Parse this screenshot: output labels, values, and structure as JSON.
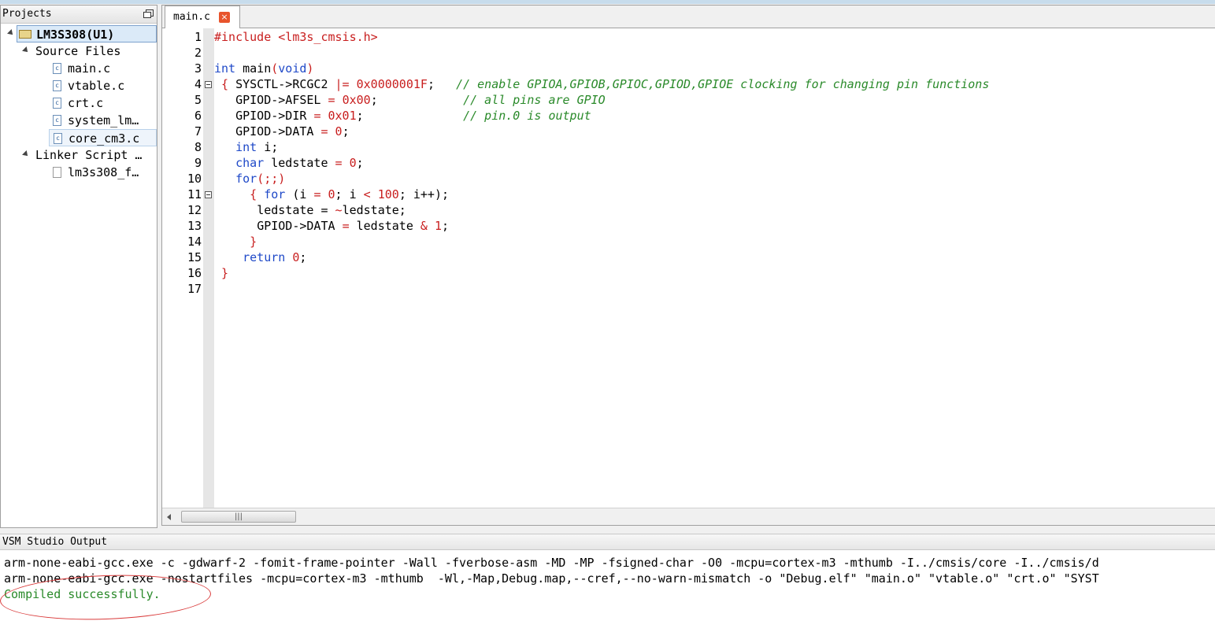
{
  "projects": {
    "title": "Projects",
    "root": "LM3S308(U1)",
    "source_folder": "Source Files",
    "source_files": [
      "main.c",
      "vtable.c",
      "crt.c",
      "system_lm…",
      "core_cm3.c"
    ],
    "linker_folder": "Linker Script …",
    "linker_files": [
      "lm3s308_f…"
    ]
  },
  "editor": {
    "tab_label": "main.c",
    "tab_close": "×",
    "scroll_grip": "|||",
    "line_numbers": [
      "1",
      "2",
      "3",
      "4",
      "5",
      "6",
      "7",
      "8",
      "9",
      "10",
      "11",
      "12",
      "13",
      "14",
      "15",
      "16",
      "17"
    ],
    "lines": [
      {
        "i": "",
        "t": [
          {
            "c": "pp",
            "v": "#include <lm3s_cmsis.h>"
          }
        ]
      },
      {
        "i": "",
        "t": []
      },
      {
        "i": "",
        "t": [
          {
            "c": "kw",
            "v": "int"
          },
          {
            "c": "",
            "v": " main"
          },
          {
            "c": "op",
            "v": "("
          },
          {
            "c": "kw",
            "v": "void"
          },
          {
            "c": "op",
            "v": ")"
          }
        ]
      },
      {
        "i": " ",
        "t": [
          {
            "c": "op",
            "v": "{"
          },
          {
            "c": "",
            "v": " SYSCTL->RCGC2 "
          },
          {
            "c": "op",
            "v": "|="
          },
          {
            "c": "",
            "v": " "
          },
          {
            "c": "num",
            "v": "0x0000001F"
          },
          {
            "c": "",
            "v": ";   "
          },
          {
            "c": "cm",
            "v": "// enable GPIOA,GPIOB,GPIOC,GPIOD,GPIOE clocking for changing pin functions"
          }
        ]
      },
      {
        "i": "   ",
        "t": [
          {
            "c": "",
            "v": "GPIOD->AFSEL "
          },
          {
            "c": "op",
            "v": "="
          },
          {
            "c": "",
            "v": " "
          },
          {
            "c": "num",
            "v": "0x00"
          },
          {
            "c": "",
            "v": ";            "
          },
          {
            "c": "cm",
            "v": "// all pins are GPIO"
          }
        ]
      },
      {
        "i": "   ",
        "t": [
          {
            "c": "",
            "v": "GPIOD->DIR "
          },
          {
            "c": "op",
            "v": "="
          },
          {
            "c": "",
            "v": " "
          },
          {
            "c": "num",
            "v": "0x01"
          },
          {
            "c": "",
            "v": ";              "
          },
          {
            "c": "cm",
            "v": "// pin.0 is output"
          }
        ]
      },
      {
        "i": "   ",
        "t": [
          {
            "c": "",
            "v": "GPIOD->DATA "
          },
          {
            "c": "op",
            "v": "="
          },
          {
            "c": "",
            "v": " "
          },
          {
            "c": "num",
            "v": "0"
          },
          {
            "c": "",
            "v": ";"
          }
        ]
      },
      {
        "i": "   ",
        "t": [
          {
            "c": "kw",
            "v": "int"
          },
          {
            "c": "",
            "v": " i;"
          }
        ]
      },
      {
        "i": "   ",
        "t": [
          {
            "c": "kw",
            "v": "char"
          },
          {
            "c": "",
            "v": " ledstate "
          },
          {
            "c": "op",
            "v": "="
          },
          {
            "c": "",
            "v": " "
          },
          {
            "c": "num",
            "v": "0"
          },
          {
            "c": "",
            "v": ";"
          }
        ]
      },
      {
        "i": "   ",
        "t": [
          {
            "c": "kw",
            "v": "for"
          },
          {
            "c": "op",
            "v": "(;;)"
          }
        ]
      },
      {
        "i": "     ",
        "t": [
          {
            "c": "op",
            "v": "{"
          },
          {
            "c": "",
            "v": " "
          },
          {
            "c": "kw",
            "v": "for"
          },
          {
            "c": "",
            "v": " (i "
          },
          {
            "c": "op",
            "v": "="
          },
          {
            "c": "",
            "v": " "
          },
          {
            "c": "num",
            "v": "0"
          },
          {
            "c": "",
            "v": "; i "
          },
          {
            "c": "op",
            "v": "<"
          },
          {
            "c": "",
            "v": " "
          },
          {
            "c": "num",
            "v": "100"
          },
          {
            "c": "",
            "v": "; i++);"
          }
        ]
      },
      {
        "i": "      ",
        "t": [
          {
            "c": "",
            "v": "ledstate = "
          },
          {
            "c": "op",
            "v": "~"
          },
          {
            "c": "",
            "v": "ledstate;"
          }
        ]
      },
      {
        "i": "      ",
        "t": [
          {
            "c": "",
            "v": "GPIOD->DATA "
          },
          {
            "c": "op",
            "v": "="
          },
          {
            "c": "",
            "v": " ledstate "
          },
          {
            "c": "op",
            "v": "&"
          },
          {
            "c": "",
            "v": " "
          },
          {
            "c": "num",
            "v": "1"
          },
          {
            "c": "",
            "v": ";"
          }
        ]
      },
      {
        "i": "     ",
        "t": [
          {
            "c": "op",
            "v": "}"
          }
        ]
      },
      {
        "i": "    ",
        "t": [
          {
            "c": "kw",
            "v": "return"
          },
          {
            "c": "",
            "v": " "
          },
          {
            "c": "num",
            "v": "0"
          },
          {
            "c": "",
            "v": ";"
          }
        ]
      },
      {
        "i": " ",
        "t": [
          {
            "c": "op",
            "v": "}"
          }
        ]
      },
      {
        "i": "",
        "t": []
      }
    ],
    "fold_lines": [
      4,
      11
    ]
  },
  "output": {
    "title": "VSM Studio Output",
    "lines": [
      "arm-none-eabi-gcc.exe -c -gdwarf-2 -fomit-frame-pointer -Wall -fverbose-asm -MD -MP -fsigned-char -O0 -mcpu=cortex-m3 -mthumb -I../cmsis/core -I../cmsis/d",
      "arm-none-eabi-gcc.exe -nostartfiles -mcpu=cortex-m3 -mthumb  -Wl,-Map,Debug.map,--cref,--no-warn-mismatch -o \"Debug.elf\" \"main.o\" \"vtable.o\" \"crt.o\" \"SYST",
      "Compiled successfully."
    ]
  },
  "colors": {
    "keyword": "#1f49c8",
    "number": "#c81e1e",
    "comment": "#2a8a2a",
    "success": "#2a8a2a",
    "annotation": "#d93a3a"
  }
}
